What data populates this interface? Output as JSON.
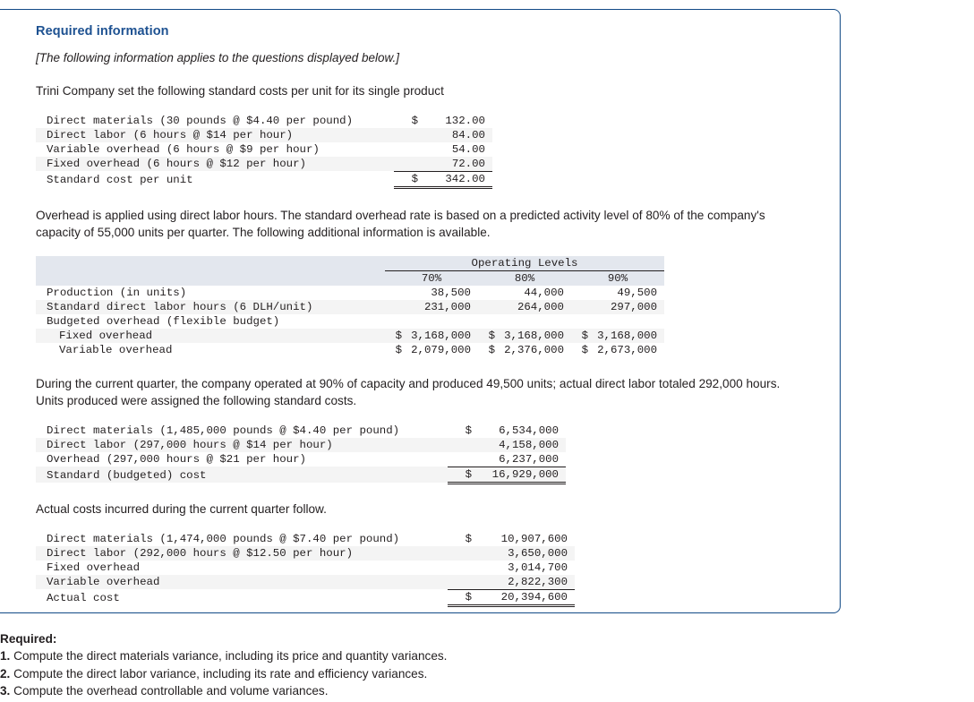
{
  "panel": {
    "title": "Required information",
    "applies_note": "[The following information applies to the questions displayed below.]",
    "intro_paragraph": "Trini Company set the following standard costs per unit for its single product",
    "overhead_paragraph": "Overhead is applied using direct labor hours. The standard overhead rate is based on a predicted activity level of 80% of the company's capacity of 55,000 units per quarter. The following additional information is available.",
    "quarter_paragraph": "During the current quarter, the company operated at 90% of capacity and produced 49,500 units; actual direct labor totaled 292,000 hours. Units produced were assigned the following standard costs.",
    "actual_paragraph": "Actual costs incurred during the current quarter follow."
  },
  "standard_cost_table": {
    "rows": [
      {
        "label": "Direct materials (30 pounds @ $4.40 per pound)",
        "currency": "$",
        "value": "132.00"
      },
      {
        "label": "Direct labor (6 hours @ $14 per hour)",
        "currency": "",
        "value": "84.00"
      },
      {
        "label": "Variable overhead (6 hours @ $9 per hour)",
        "currency": "",
        "value": "54.00"
      },
      {
        "label": "Fixed overhead (6 hours @ $12 per hour)",
        "currency": "",
        "value": "72.00"
      }
    ],
    "total": {
      "label": "Standard cost per unit",
      "currency": "$",
      "value": "342.00"
    }
  },
  "operating_levels_table": {
    "group_header": "Operating Levels",
    "column_headers": [
      "70%",
      "80%",
      "90%"
    ],
    "rows": [
      {
        "label": "Production (in units)",
        "indent": false,
        "currency": "",
        "values": [
          "38,500",
          "44,000",
          "49,500"
        ]
      },
      {
        "label": "Standard direct labor hours (6 DLH/unit)",
        "indent": false,
        "currency": "",
        "values": [
          "231,000",
          "264,000",
          "297,000"
        ]
      },
      {
        "label": "Budgeted overhead (flexible budget)",
        "indent": false,
        "currency": "",
        "values": [
          "",
          "",
          ""
        ]
      },
      {
        "label": "Fixed overhead",
        "indent": true,
        "currency": "$",
        "values": [
          "3,168,000",
          "3,168,000",
          "3,168,000"
        ]
      },
      {
        "label": "Variable overhead",
        "indent": true,
        "currency": "$",
        "values": [
          "2,079,000",
          "2,376,000",
          "2,673,000"
        ]
      }
    ]
  },
  "standard_budgeted_table": {
    "rows": [
      {
        "label": "Direct materials (1,485,000 pounds @ $4.40 per pound)",
        "currency": "$",
        "value": "6,534,000"
      },
      {
        "label": "Direct labor (297,000 hours @ $14 per hour)",
        "currency": "",
        "value": "4,158,000"
      },
      {
        "label": "Overhead (297,000 hours @ $21 per hour)",
        "currency": "",
        "value": "6,237,000"
      }
    ],
    "total": {
      "label": "Standard (budgeted) cost",
      "currency": "$",
      "value": "16,929,000"
    }
  },
  "actual_cost_table": {
    "rows": [
      {
        "label": "Direct materials (1,474,000 pounds @ $7.40 per pound)",
        "currency": "$",
        "value": "10,907,600"
      },
      {
        "label": "Direct labor (292,000 hours @ $12.50 per hour)",
        "currency": "",
        "value": "3,650,000"
      },
      {
        "label": "Fixed overhead",
        "currency": "",
        "value": "3,014,700"
      },
      {
        "label": "Variable overhead",
        "currency": "",
        "value": "2,822,300"
      }
    ],
    "total": {
      "label": "Actual cost",
      "currency": "$",
      "value": "20,394,600"
    }
  },
  "required": {
    "heading": "Required:",
    "items": [
      {
        "num": "1.",
        "text": "Compute the direct materials variance, including its price and quantity variances."
      },
      {
        "num": "2.",
        "text": "Compute the direct labor variance, including its rate and efficiency variances."
      },
      {
        "num": "3.",
        "text": "Compute the overhead controllable and volume variances."
      }
    ]
  },
  "colors": {
    "heading_blue": "#1d5191",
    "panel_border": "#124a86",
    "row_stripe": "#f4f4f4",
    "header_stripe": "#e3e7ee"
  }
}
